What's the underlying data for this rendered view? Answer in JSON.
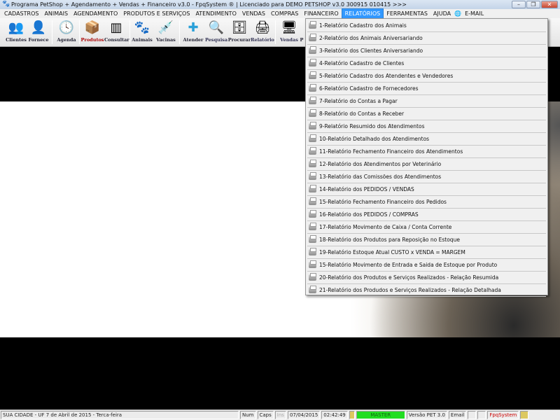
{
  "title": "Programa PetShop + Agendamento + Vendas + Financeiro v3.0 - FpqSystem ® | Licenciado para  DEMO PETSHOP v3.0 300915 010415 >>>",
  "window_buttons": {
    "minimize": "–",
    "maximize": "❐",
    "close": "✕"
  },
  "menu": [
    "CADASTROS",
    "ANIMAIS",
    "AGENDAMENTO",
    "PRODUTOS E SERVIÇOS",
    "ATENDIMENTO",
    "VENDAS",
    "COMPRAS",
    "FINANCEIRO",
    "RELATÓRIOS",
    "FERRAMENTAS",
    "AJUDA",
    "E-MAIL"
  ],
  "toolbar": [
    {
      "label": "Clientes",
      "icon": "👥"
    },
    {
      "label": "Fornece",
      "icon": "👤"
    },
    {
      "label": "Agenda",
      "icon": "🕓"
    },
    {
      "label": "Produtos",
      "icon": "📦"
    },
    {
      "label": "Consultar",
      "icon": "▥"
    },
    {
      "label": "Animais",
      "icon": "🐾"
    },
    {
      "label": "Vacinas",
      "icon": "💉"
    },
    {
      "label": "Atender",
      "icon": "✚"
    },
    {
      "label": "Pesquisa",
      "icon": "🔍"
    },
    {
      "label": "Procurar",
      "icon": "🗄"
    },
    {
      "label": "Relatório",
      "icon": "🖨"
    },
    {
      "label": "Vendas",
      "icon": "🖥"
    },
    {
      "label": "P",
      "icon": ""
    }
  ],
  "reports_menu": [
    "1-Relatório Cadastro dos Animais",
    "2-Relatório dos Animais Aniversariando",
    "3-Relatório dos Clientes Aniversariando",
    "4-Relatório Cadastro de Clientes",
    "5-Relatório Cadastro dos Atendentes e Vendedores",
    "6-Relatório Cadastro de Fornecedores",
    "7-Relatório do Contas a Pagar",
    "8-Relatório do Contas a Receber",
    "9-Relatório Resumido dos Atendimentos",
    "10-Relatório Detalhado dos Atendimentos",
    "11-Relatório Fechamento Financeiro dos Atendimentos",
    "12-Relatório dos Atendimentos por Veterinário",
    "13-Relatório das Comissões dos Atendimentos",
    "14-Relatório dos PEDIDOS / VENDAS",
    "15-Relatório Fechamento Financeiro dos Pedidos",
    "16-Relatório dos PEDIDOS / COMPRAS",
    "17-Relatório Movimento de Caixa / Conta Corrente",
    "18-Relatório dos Produtos para Reposição no Estoque",
    "19-Relatório Estoque Atual CUSTO x VENDA = MARGEM",
    "15-Relatório Movimento de Entrada e Saida de Estoque por Produto",
    "20-Relatório dos Produtos e Serviços Realizados - Relação Resumida",
    "21-Relatório dos Produdos e Serviços Realizados - Relação Detalhada"
  ],
  "status": {
    "city_date": "SUA CIDADE - UF  7 de Abril de 2015 - Terca-feira",
    "num": "Num",
    "caps": "Caps",
    "ins": "Ins",
    "date": "07/04/2015",
    "time": "02:42:49",
    "user": "MASTER",
    "version": "Versão PET 3.0",
    "email": "Email",
    "brand": "FpqSystem"
  },
  "colors": {
    "menu_active": "#3399ff",
    "user_badge": "#22dd22",
    "brand": "#cc0000"
  }
}
